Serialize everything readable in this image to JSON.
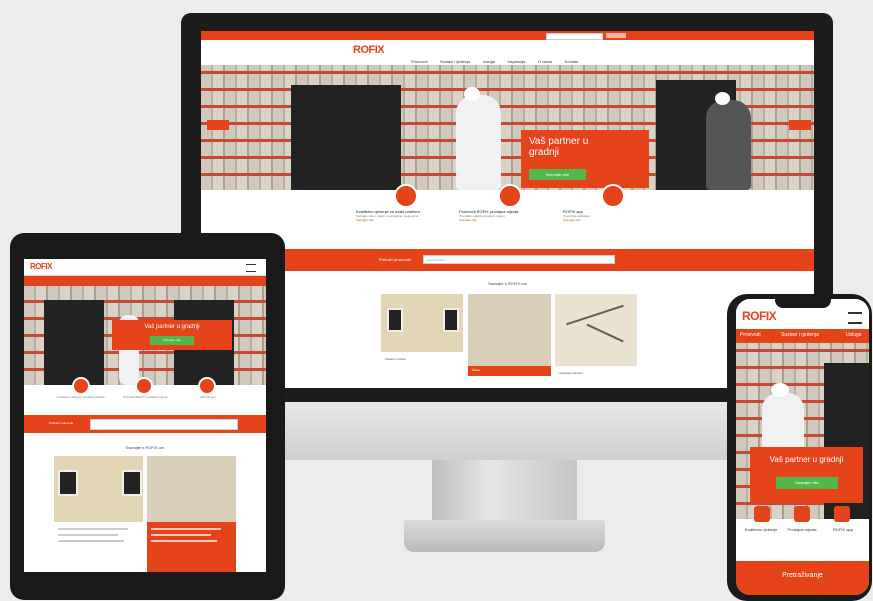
{
  "desktop": {
    "hero_heading": "Vaš partner u gradnji",
    "hero_button": "Saznajte više",
    "search_label": "Pretraži proizvode",
    "search_placeholder": "Pretraživanje...",
    "nav": [
      "Proizvodi",
      "Sustavi i rješenja",
      "Usluge",
      "Inspiracija",
      "O nama",
      "Kontakt"
    ],
    "features": [
      {
        "title": "Kvalitetno rješenje za svaki problem",
        "text": "Saznajte više o našim proizvodima i rješenjima",
        "link": "Saznajte više"
      },
      {
        "title": "Proizvodi ROFIX prodajna mjesta",
        "text": "Pronađite najbliže prodajno mjesto",
        "link": "Saznajte više"
      },
      {
        "title": "ROFIX app",
        "text": "Preuzmite aplikaciju",
        "link": "Saznajte više"
      }
    ],
    "section_title": "Saznajte s ROFIX-om",
    "cards": [
      "Fasadni sustavi",
      "Žbuke",
      "Sanacija pukotina"
    ]
  },
  "tablet": {
    "hero_heading": "Vaš partner u gradnji",
    "hero_button": "Saznajte više",
    "search_label": "Pretraži proizvode",
    "section_title": "Saznajte s ROFIX-om",
    "features": [
      "Kvalitetno rješenje za svaki problem",
      "Proizvodi ROFIX prodajna mjesta",
      "ROFIX app"
    ]
  },
  "phone": {
    "brand": "ROFIX",
    "nav": [
      "Proizvodi",
      "Sustavi i rješenja",
      "Usluge"
    ],
    "hero_heading": "Vaš partner u gradnji",
    "hero_button": "Saznajte više",
    "features": [
      "Kvalitetno rješenje",
      "Prodajna mjesta",
      "ROFIX app"
    ],
    "footer_button": "Pretraživanje"
  },
  "brand": "ROFIX",
  "colors": {
    "accent": "#e5431a",
    "button": "#54b74a"
  }
}
